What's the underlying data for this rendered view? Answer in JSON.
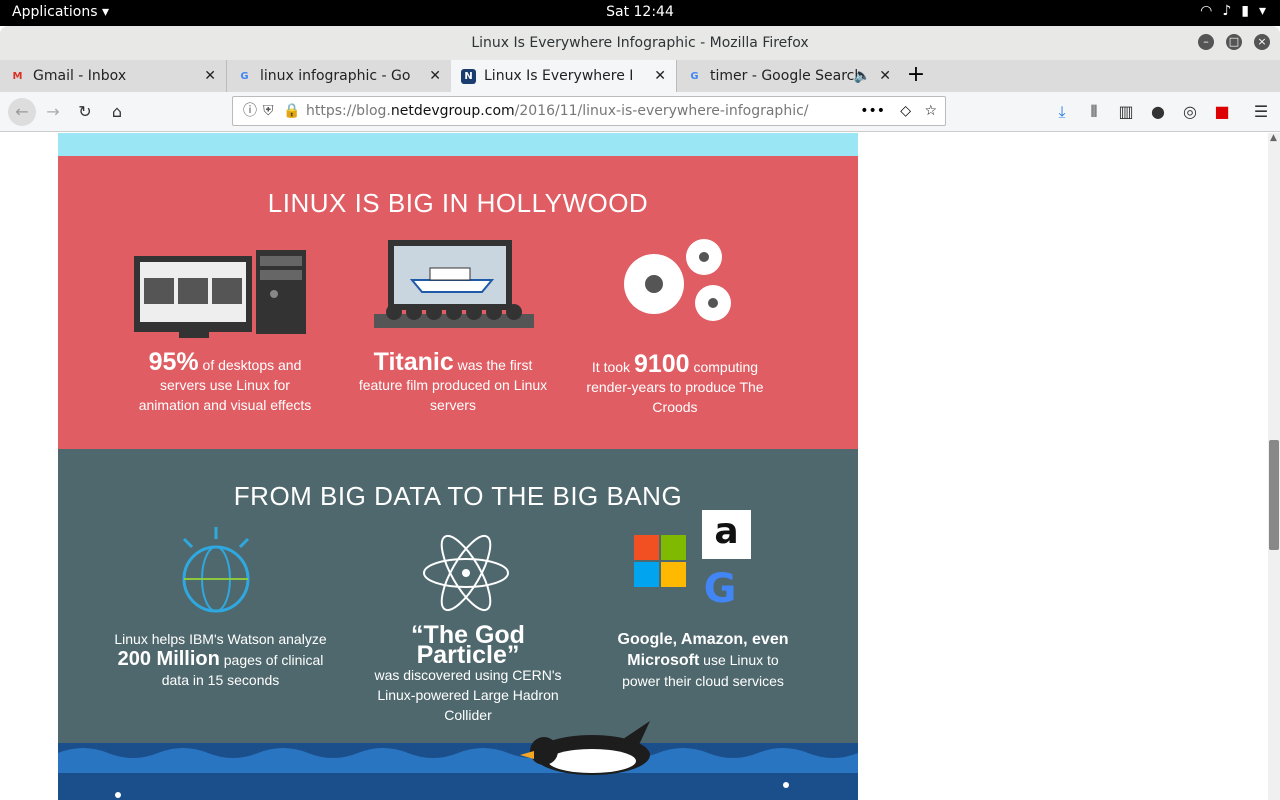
{
  "system": {
    "applications": "Applications",
    "clock": "Sat 12:44"
  },
  "window": {
    "title": "Linux Is Everywhere Infographic - Mozilla Firefox"
  },
  "tabs": [
    {
      "label": "Gmail - Inbox"
    },
    {
      "label": "linux infographic - Google"
    },
    {
      "label": "Linux Is Everywhere Infogr"
    },
    {
      "label": "timer - Google Search"
    }
  ],
  "url": {
    "prefix": "https://blog.",
    "domain": "netdevgroup.com",
    "path": "/2016/11/linux-is-everywhere-infographic/"
  },
  "hollywood": {
    "heading": "LINUX IS BIG IN HOLLYWOOD",
    "f1_big": "95%",
    "f1_rest": " of desktops and servers use Linux for animation and visual effects",
    "f2_big": "Titanic",
    "f2_rest": " was the first feature film produced on Linux servers",
    "f3_pre": "It took ",
    "f3_big": "9100",
    "f3_rest": " computing render-years to produce The Croods"
  },
  "bigdata": {
    "heading": "FROM BIG DATA TO THE BIG BANG",
    "f1_pre": "Linux helps IBM's Watson analyze",
    "f1_big": "200 Million",
    "f1_rest": " pages of clinical data in 15 seconds",
    "f2_big": "“The God Particle”",
    "f2_rest": "was discovered using CERN's Linux-powered Large Hadron Collider",
    "f3_big": "Google, Amazon, even Microsoft",
    "f3_rest": " use Linux to power their cloud services"
  }
}
